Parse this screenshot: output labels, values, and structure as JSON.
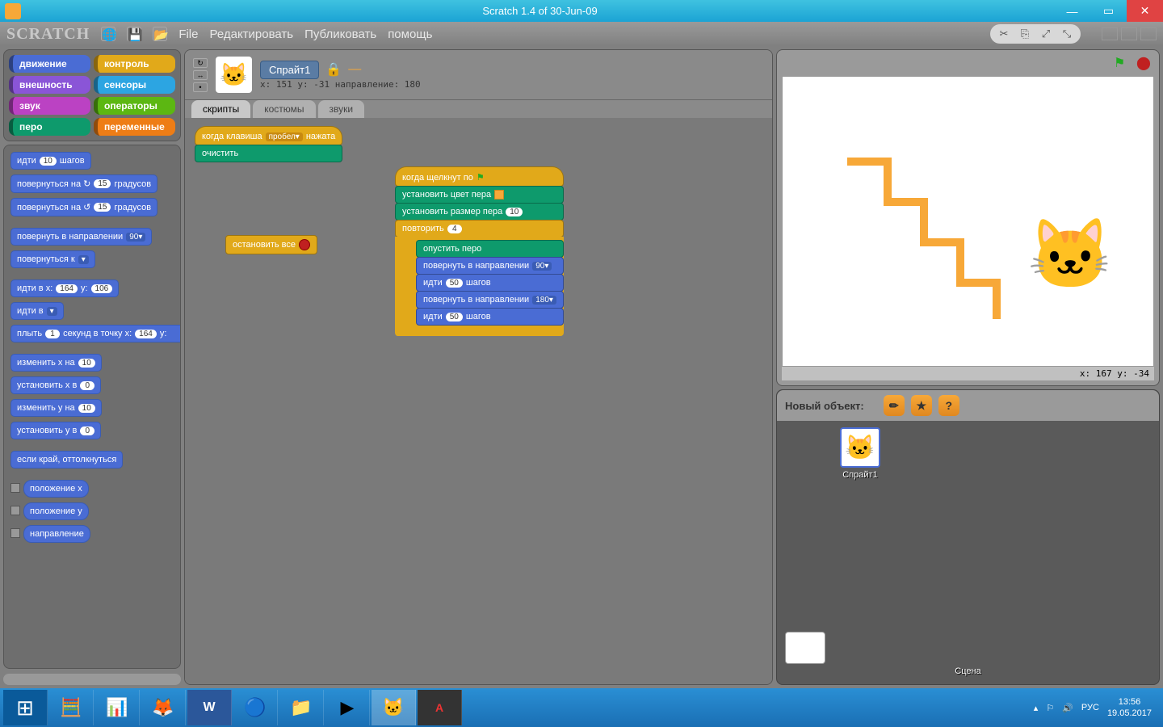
{
  "window": {
    "title": "Scratch 1.4 of 30-Jun-09"
  },
  "menu": {
    "logo": "SCRATCH",
    "items": [
      "File",
      "Редактировать",
      "Публиковать",
      "помощь"
    ]
  },
  "categories": [
    {
      "label": "движение",
      "cls": "c-motion"
    },
    {
      "label": "контроль",
      "cls": "c-control"
    },
    {
      "label": "внешность",
      "cls": "c-looks"
    },
    {
      "label": "сенсоры",
      "cls": "c-sense"
    },
    {
      "label": "звук",
      "cls": "c-sound"
    },
    {
      "label": "операторы",
      "cls": "c-ops"
    },
    {
      "label": "перо",
      "cls": "c-pen"
    },
    {
      "label": "переменные",
      "cls": "c-vars"
    }
  ],
  "palette_blocks": {
    "b1": {
      "pre": "идти",
      "v": "10",
      "post": "шагов"
    },
    "b2": {
      "pre": "повернуться на ↻",
      "v": "15",
      "post": "градусов"
    },
    "b3": {
      "pre": "повернуться на ↺",
      "v": "15",
      "post": "градусов"
    },
    "b4": {
      "pre": "повернуть в направлении",
      "v": "90▾"
    },
    "b5": {
      "pre": "повернуться к",
      "v": "    ▾"
    },
    "b6": {
      "pre": "идти в x:",
      "v": "164",
      "mid": "y:",
      "v2": "106"
    },
    "b7": {
      "pre": "идти в",
      "v": "    ▾"
    },
    "b8": {
      "pre": "плыть",
      "v": "1",
      "mid": "секунд в точку x:",
      "v2": "164",
      "mid2": "y:",
      "v3": ""
    },
    "b9": {
      "pre": "изменить x на",
      "v": "10"
    },
    "b10": {
      "pre": "установить x в",
      "v": "0"
    },
    "b11": {
      "pre": "изменить y на",
      "v": "10"
    },
    "b12": {
      "pre": "установить y в",
      "v": "0"
    },
    "b13": {
      "pre": "если край, оттолкнуться"
    },
    "r1": "положение x",
    "r2": "положение y",
    "r3": "направление"
  },
  "sprite": {
    "name": "Спрайт1",
    "info": "x: 151  y: -31  направление: 180",
    "tabs": [
      "скрипты",
      "костюмы",
      "звуки"
    ],
    "active_tab": 0
  },
  "scripts": {
    "s1": {
      "l1_pre": "когда клавиша",
      "l1_drop": "пробел▾",
      "l1_post": "нажата",
      "l2": "очистить"
    },
    "s2": {
      "l": "остановить все"
    },
    "s3": {
      "l1": "когда щелкнут по",
      "l2": "установить цвет пера",
      "l3_pre": "установить размер пера",
      "l3_v": "10",
      "l4_pre": "повторить",
      "l4_v": "4",
      "c1": "опустить перо",
      "c2_pre": "повернуть в направлении",
      "c2_v": "90▾",
      "c3_pre": "идти",
      "c3_v": "50",
      "c3_post": "шагов",
      "c4_pre": "повернуть в направлении",
      "c4_v": "180▾",
      "c5_pre": "идти",
      "c5_v": "50",
      "c5_post": "шагов"
    }
  },
  "stage": {
    "coords": "x: 167   y: -34",
    "new_obj": "Новый объект:",
    "scene": "Сцена"
  },
  "taskbar": {
    "lang": "РУС",
    "time": "13:56",
    "date": "19.05.2017"
  }
}
